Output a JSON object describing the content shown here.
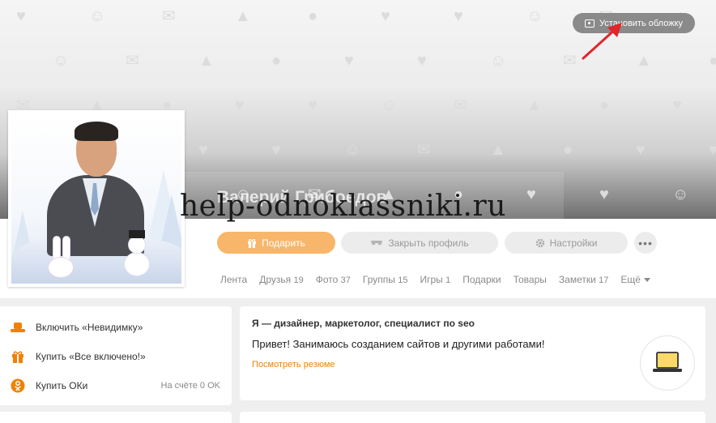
{
  "cover": {
    "set_cover_label": "Установить обложку"
  },
  "profile": {
    "name": "Валерий Грибоедов",
    "watermark": "help-odnoklassniki.ru"
  },
  "actions": {
    "gift_label": "Подарить",
    "close_profile_label": "Закрыть профиль",
    "settings_label": "Настройки",
    "more_label": "•••"
  },
  "tabs": [
    {
      "label": "Лента",
      "count": ""
    },
    {
      "label": "Друзья",
      "count": "19"
    },
    {
      "label": "Фото",
      "count": "37"
    },
    {
      "label": "Группы",
      "count": "15"
    },
    {
      "label": "Игры",
      "count": "1"
    },
    {
      "label": "Подарки",
      "count": ""
    },
    {
      "label": "Товары",
      "count": ""
    },
    {
      "label": "Заметки",
      "count": "17"
    }
  ],
  "tabs_more_label": "Ещё",
  "sidebar": {
    "items": [
      {
        "label": "Включить «Невидимку»",
        "icon": "hat-icon"
      },
      {
        "label": "Купить «Все включено!»",
        "icon": "gift-box-icon"
      },
      {
        "label": "Купить ОКи",
        "icon": "ok-coin-icon"
      }
    ],
    "balance": "На счёте 0 OK"
  },
  "about": {
    "title": "Я — дизайнер, маркетолог, специалист по seo",
    "text": "Привет! Занимаюсь созданием сайтов и другими работами!",
    "link": "Посмотреть резюме"
  },
  "colors": {
    "accent": "#ee8208",
    "gift_button": "#f7b66a",
    "annotation_arrow": "#e0262b"
  }
}
